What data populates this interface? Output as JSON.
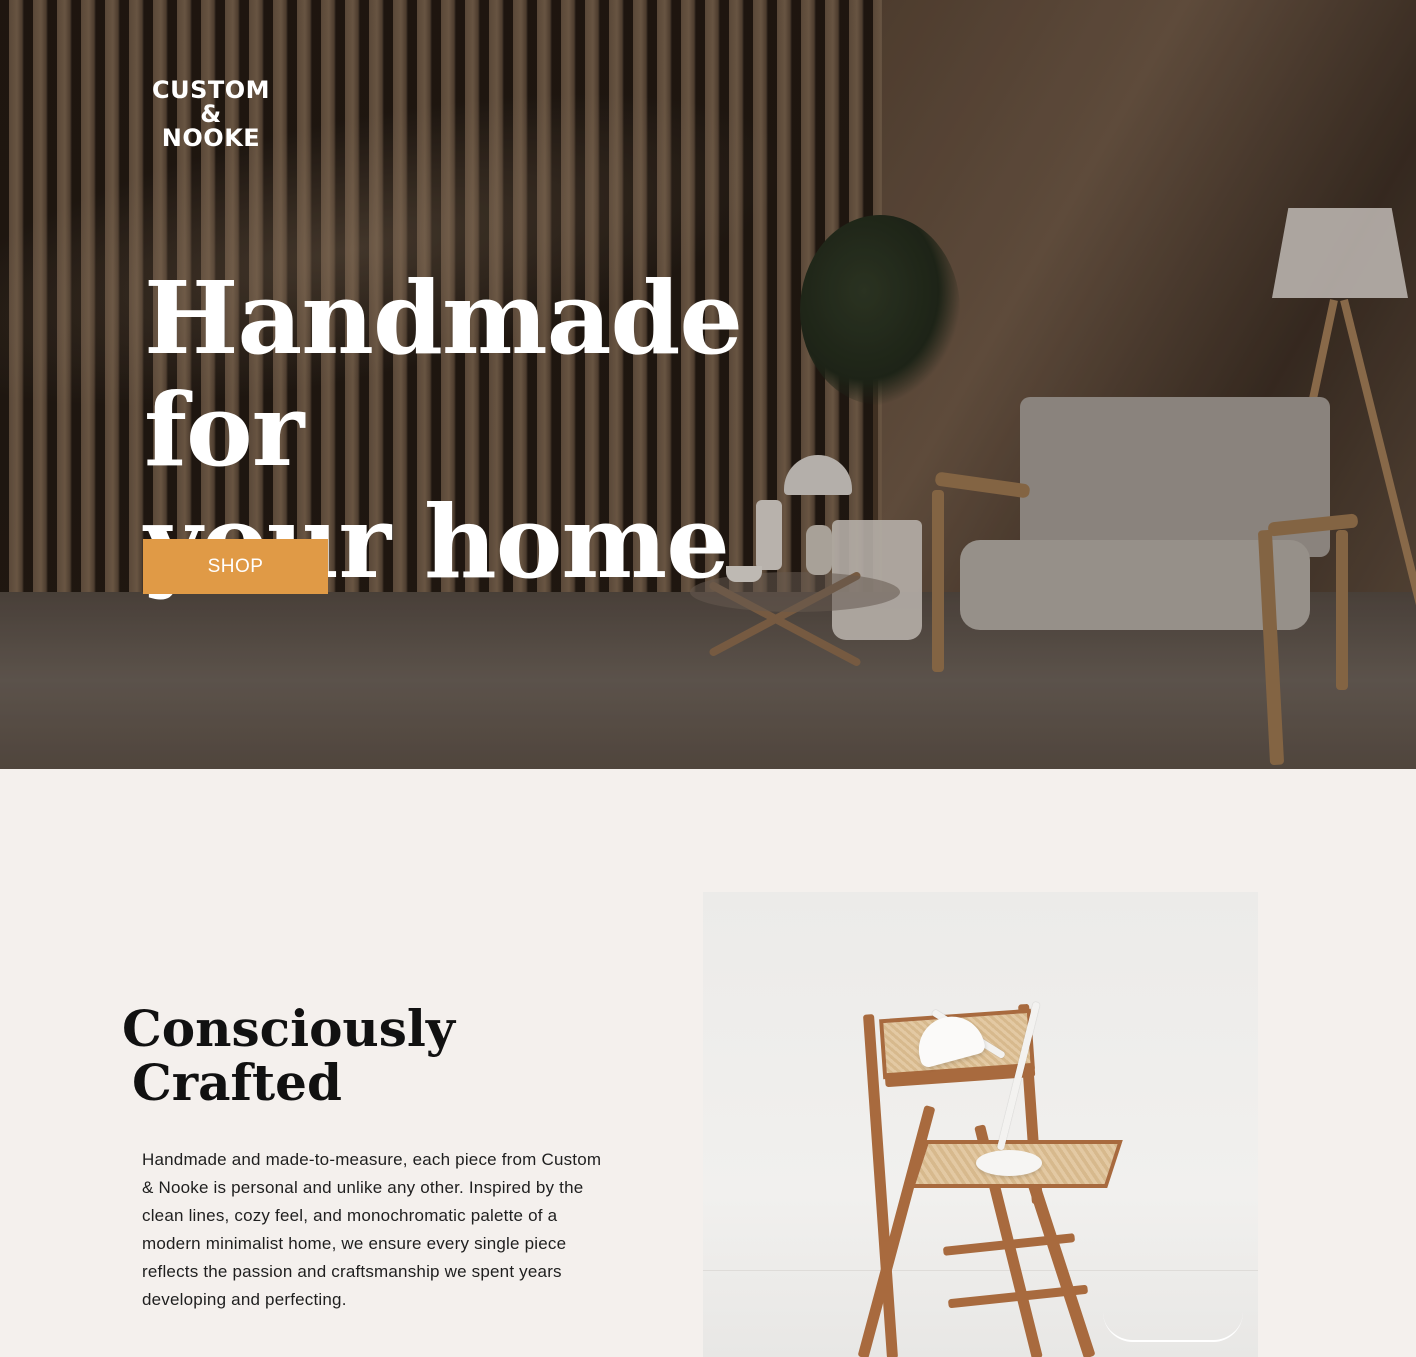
{
  "brand": {
    "logo_line1": "CUSTOM",
    "logo_line2": "& NOOKE"
  },
  "hero": {
    "title_line1": "Handmade for",
    "title_line2": "your home",
    "cta_label": "SHOP"
  },
  "about": {
    "title_line1": "Consciously",
    "title_line2": "Crafted",
    "body": "Handmade and made-to-measure, each piece from Custom & Nooke is personal and unlike any other. Inspired by the clean lines, cozy feel, and monochromatic palette of a modern minimalist home, we ensure every single piece reflects the passion and craftsmanship we spent years developing and perfecting."
  },
  "colors": {
    "accent": "#e09a46",
    "section_bg": "#f4f0ed",
    "text_dark": "#111111"
  }
}
